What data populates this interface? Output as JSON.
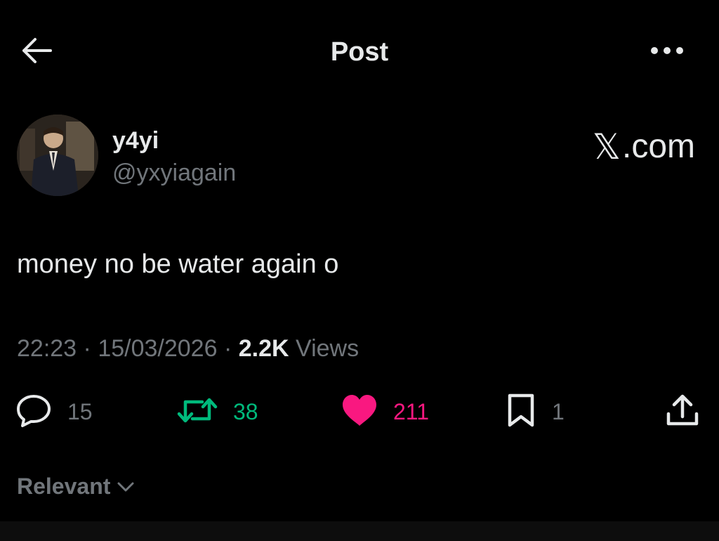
{
  "header": {
    "title": "Post",
    "back_icon": "arrow-left-icon",
    "more_icon": "more-horizontal-icon"
  },
  "author": {
    "display_name": "y4yi",
    "handle": "@yxyiagain"
  },
  "watermark": {
    "glyph": "𝕏",
    "text": ".com"
  },
  "post": {
    "text": "money no be water again o",
    "time": "22:23",
    "separator": "·",
    "date": "15/03/2026",
    "views_count": "2.2K",
    "views_label": "Views"
  },
  "actions": {
    "replies": "15",
    "reposts": "38",
    "likes": "211",
    "bookmarks": "1"
  },
  "sort": {
    "label": "Relevant"
  },
  "colors": {
    "background": "#000000",
    "text": "#e7e9ea",
    "muted": "#71767b",
    "repost_green": "#00ba7c",
    "like_pink": "#f91880"
  }
}
